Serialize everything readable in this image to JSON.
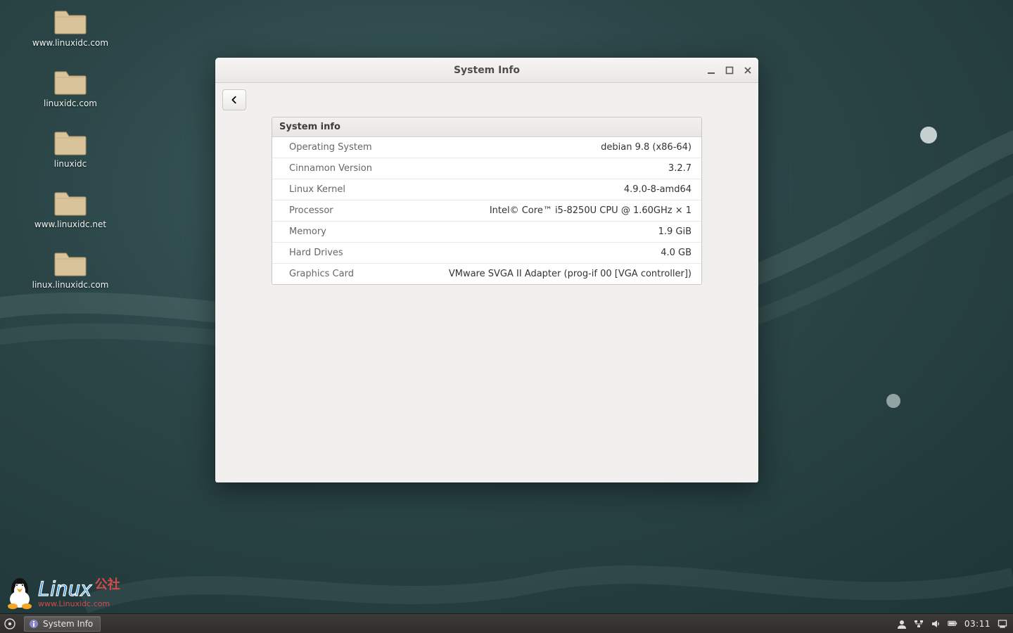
{
  "desktop": {
    "icons": [
      {
        "label": "www.linuxidc.com"
      },
      {
        "label": "linuxidc.com"
      },
      {
        "label": "linuxidc"
      },
      {
        "label": "www.linuxidc.net"
      },
      {
        "label": "linux.linuxidc.com"
      }
    ]
  },
  "window": {
    "title": "System Info",
    "panel_header": "System info",
    "rows": [
      {
        "label": "Operating System",
        "value": "debian 9.8 (x86-64)"
      },
      {
        "label": "Cinnamon Version",
        "value": "3.2.7"
      },
      {
        "label": "Linux Kernel",
        "value": "4.9.0-8-amd64"
      },
      {
        "label": "Processor",
        "value": "Intel© Core™ i5-8250U CPU @ 1.60GHz × 1"
      },
      {
        "label": "Memory",
        "value": "1.9 GiB"
      },
      {
        "label": "Hard Drives",
        "value": "4.0 GB"
      },
      {
        "label": "Graphics Card",
        "value": "VMware SVGA II Adapter (prog-if 00 [VGA controller])"
      }
    ]
  },
  "taskbar": {
    "active_task": "System Info",
    "clock": "03:11"
  },
  "watermark": {
    "text": "Linux",
    "cn": "公社",
    "sub": "www.Linuxidc.com"
  }
}
